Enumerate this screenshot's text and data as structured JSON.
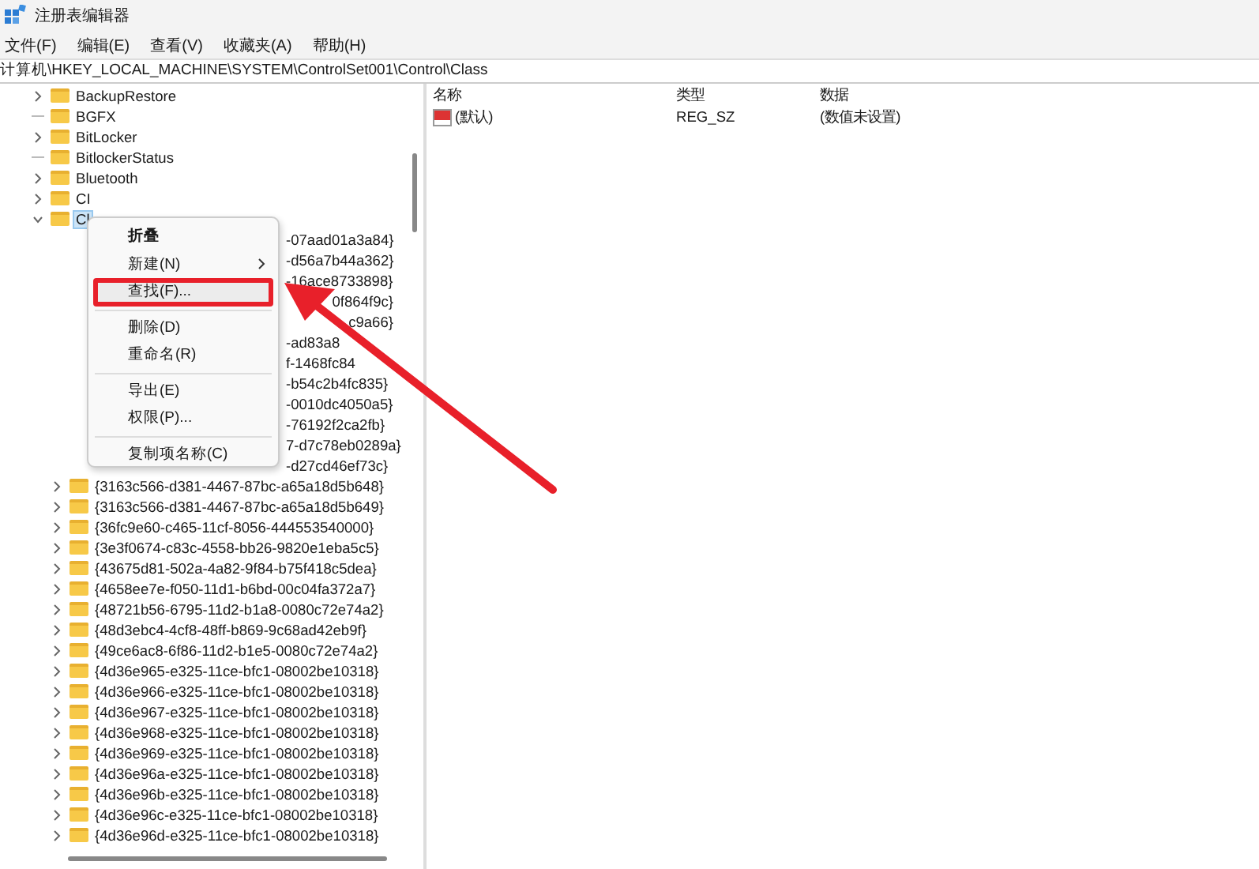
{
  "window": {
    "title": "注册表编辑器"
  },
  "menu_bar": [
    "文件(F)",
    "编辑(E)",
    "查看(V)",
    "收藏夹(A)",
    "帮助(H)"
  ],
  "address": "计算机\\HKEY_LOCAL_MACHINE\\SYSTEM\\ControlSet001\\Control\\Class",
  "tree": [
    {
      "label": "BackupRestore",
      "expandable": true,
      "expanded": false,
      "selected": false
    },
    {
      "label": "BGFX",
      "expandable": false,
      "selected": false
    },
    {
      "label": "BitLocker",
      "expandable": true,
      "expanded": false,
      "selected": false
    },
    {
      "label": "BitlockerStatus",
      "expandable": false,
      "selected": false
    },
    {
      "label": "Bluetooth",
      "expandable": true,
      "expanded": false,
      "selected": false
    },
    {
      "label": "CI",
      "expandable": true,
      "expanded": false,
      "selected": false
    },
    {
      "label": "Cl",
      "expandable": true,
      "expanded": true,
      "selected": true,
      "children": [
        {
          "label": "-07aad01a3a84}",
          "kind": "partial",
          "right_aligned": false
        },
        {
          "label": "-d56a7b44a362}",
          "kind": "partial",
          "right_aligned": false
        },
        {
          "label": "-16ace8733898}",
          "kind": "partial",
          "right_aligned": false
        },
        {
          "label": "0f864f9c}",
          "kind": "partial",
          "right_aligned": true
        },
        {
          "label": "c9a66}",
          "kind": "partial",
          "right_aligned": true
        },
        {
          "label": "-ad83a8",
          "kind": "partial",
          "right_aligned": false
        },
        {
          "label": "f-1468fc84",
          "kind": "partial",
          "right_aligned": false
        },
        {
          "label": "-b54c2b4fc835}",
          "kind": "partial",
          "right_aligned": false
        },
        {
          "label": "-0010dc4050a5}",
          "kind": "partial",
          "right_aligned": false
        },
        {
          "label": "-76192f2ca2fb}",
          "kind": "partial",
          "right_aligned": false
        },
        {
          "label": "7-d7c78eb0289a}",
          "kind": "partial",
          "right_aligned": false
        },
        {
          "label": "-d27cd46ef73c}",
          "kind": "partial",
          "right_aligned": false
        },
        {
          "label": "{3163c566-d381-4467-87bc-a65a18d5b648}",
          "kind": "full"
        },
        {
          "label": "{3163c566-d381-4467-87bc-a65a18d5b649}",
          "kind": "full"
        },
        {
          "label": "{36fc9e60-c465-11cf-8056-444553540000}",
          "kind": "full"
        },
        {
          "label": "{3e3f0674-c83c-4558-bb26-9820e1eba5c5}",
          "kind": "full"
        },
        {
          "label": "{43675d81-502a-4a82-9f84-b75f418c5dea}",
          "kind": "full"
        },
        {
          "label": "{4658ee7e-f050-11d1-b6bd-00c04fa372a7}",
          "kind": "full"
        },
        {
          "label": "{48721b56-6795-11d2-b1a8-0080c72e74a2}",
          "kind": "full"
        },
        {
          "label": "{48d3ebc4-4cf8-48ff-b869-9c68ad42eb9f}",
          "kind": "full"
        },
        {
          "label": "{49ce6ac8-6f86-11d2-b1e5-0080c72e74a2}",
          "kind": "full"
        },
        {
          "label": "{4d36e965-e325-11ce-bfc1-08002be10318}",
          "kind": "full"
        },
        {
          "label": "{4d36e966-e325-11ce-bfc1-08002be10318}",
          "kind": "full"
        },
        {
          "label": "{4d36e967-e325-11ce-bfc1-08002be10318}",
          "kind": "full"
        },
        {
          "label": "{4d36e968-e325-11ce-bfc1-08002be10318}",
          "kind": "full"
        },
        {
          "label": "{4d36e969-e325-11ce-bfc1-08002be10318}",
          "kind": "full"
        },
        {
          "label": "{4d36e96a-e325-11ce-bfc1-08002be10318}",
          "kind": "full"
        },
        {
          "label": "{4d36e96b-e325-11ce-bfc1-08002be10318}",
          "kind": "full"
        },
        {
          "label": "{4d36e96c-e325-11ce-bfc1-08002be10318}",
          "kind": "full"
        },
        {
          "label": "{4d36e96d-e325-11ce-bfc1-08002be10318}",
          "kind": "full"
        }
      ]
    }
  ],
  "list": {
    "columns": [
      "名称",
      "类型",
      "数据"
    ],
    "rows": [
      {
        "name": "(默认)",
        "type": "REG_SZ",
        "data": "(数值未设置)"
      }
    ]
  },
  "context_menu": [
    {
      "kind": "item",
      "label": "折叠",
      "bold": true,
      "submenu": false,
      "highlighted": false
    },
    {
      "kind": "item",
      "label": "新建(N)",
      "bold": false,
      "submenu": true,
      "highlighted": false
    },
    {
      "kind": "item",
      "label": "查找(F)...",
      "bold": false,
      "submenu": false,
      "highlighted": true
    },
    {
      "kind": "separator"
    },
    {
      "kind": "item",
      "label": "删除(D)",
      "bold": false,
      "submenu": false,
      "highlighted": false
    },
    {
      "kind": "item",
      "label": "重命名(R)",
      "bold": false,
      "submenu": false,
      "highlighted": false
    },
    {
      "kind": "separator"
    },
    {
      "kind": "item",
      "label": "导出(E)",
      "bold": false,
      "submenu": false,
      "highlighted": false
    },
    {
      "kind": "item",
      "label": "权限(P)...",
      "bold": false,
      "submenu": false,
      "highlighted": false
    },
    {
      "kind": "separator"
    },
    {
      "kind": "item",
      "label": "复制项名称(C)",
      "bold": false,
      "submenu": false,
      "highlighted": false
    }
  ]
}
